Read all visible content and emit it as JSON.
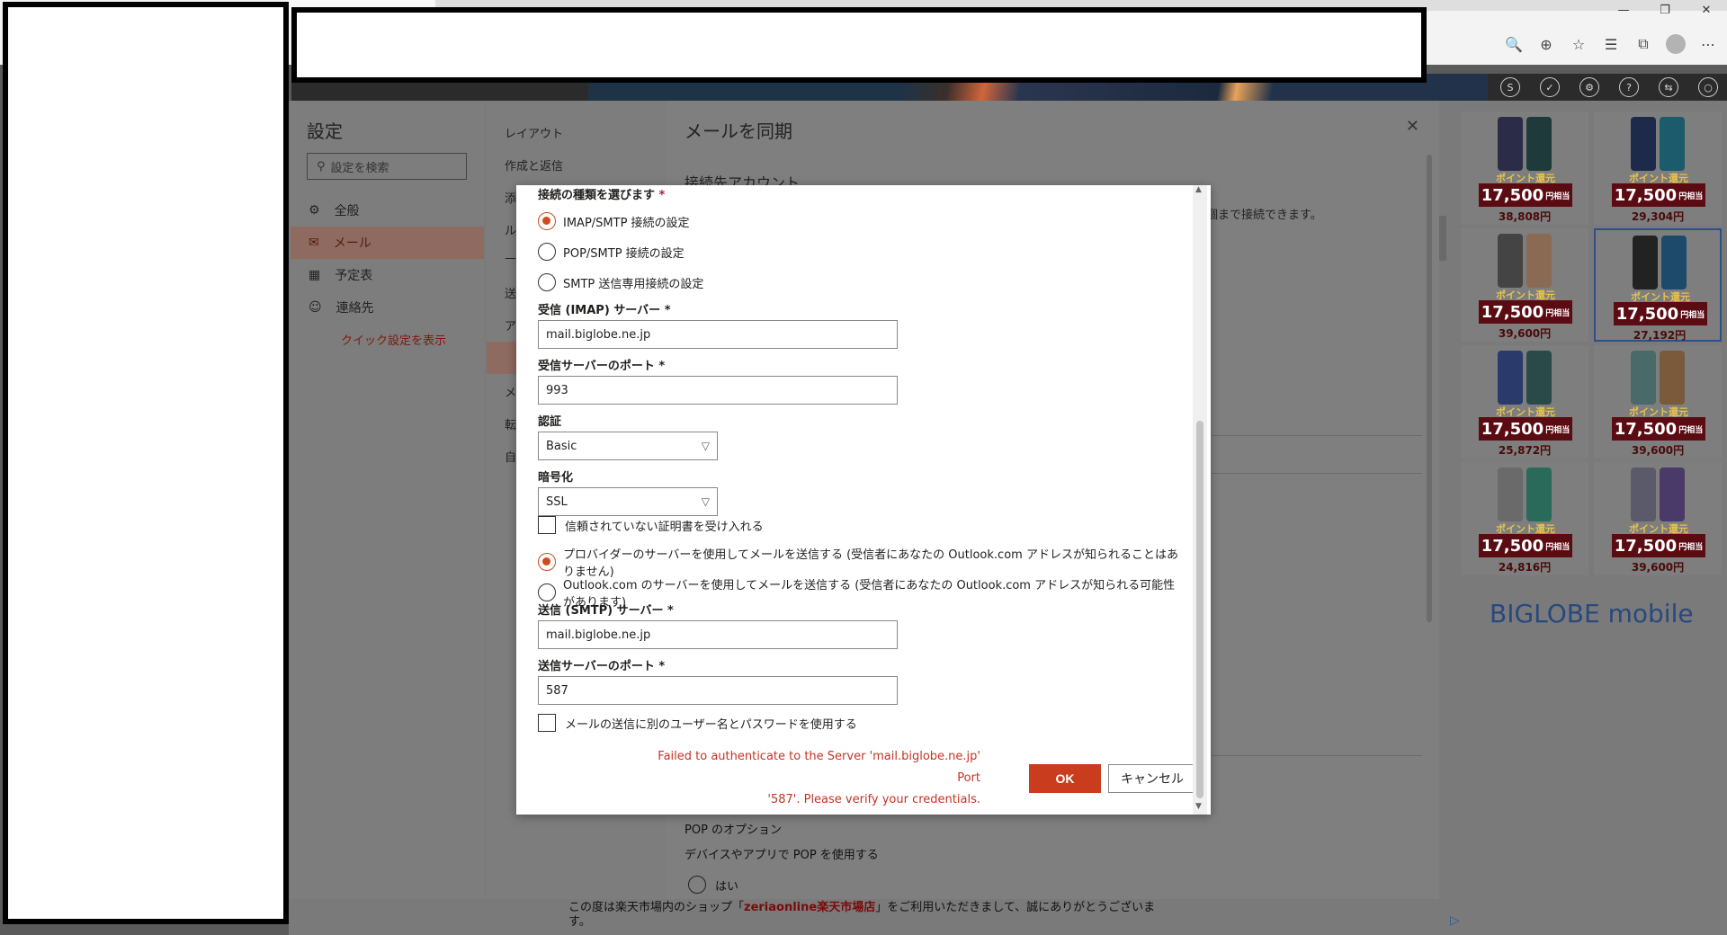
{
  "browser": {
    "window_controls": [
      "—",
      "❐",
      "✕"
    ],
    "toolbar_icons": [
      "🔍",
      "⊕",
      "☆",
      "☰",
      "⧉",
      "⋯"
    ]
  },
  "outlook_header_icons": [
    "S",
    "✓",
    "⚙",
    "?",
    "⇆",
    "○"
  ],
  "settings": {
    "title": "設定",
    "search_placeholder": "設定を検索",
    "nav": [
      {
        "label": "全般",
        "icon": "⚙"
      },
      {
        "label": "メール",
        "icon": "✉"
      },
      {
        "label": "予定表",
        "icon": "▦"
      },
      {
        "label": "連絡先",
        "icon": "☺"
      }
    ],
    "quick_settings": "クイック設定を表示",
    "mail_subnav": [
      "レイアウト",
      "作成と返信",
      "添",
      "ル",
      "—",
      "送",
      "ア",
      "メ",
      "メ",
      "転",
      "自"
    ]
  },
  "sync_panel": {
    "title": "メールを同期",
    "subtitle": "接続先アカウント",
    "side_text": "個まで接続できます。",
    "pop_options": "POP のオプション",
    "pop_use": "デバイスやアプリで POP を使用する",
    "pop_yes": "はい"
  },
  "modal": {
    "connection_type_label": "接続の種類を選びます",
    "required_mark": "*",
    "connection_options": [
      {
        "label": "IMAP/SMTP 接続の設定",
        "checked": true
      },
      {
        "label": "POP/SMTP 接続の設定",
        "checked": false
      },
      {
        "label": "SMTP 送信専用接続の設定",
        "checked": false
      }
    ],
    "incoming_server_label": "受信 (IMAP) サーバー *",
    "incoming_server_value": "mail.biglobe.ne.jp",
    "incoming_port_label": "受信サーバーのポート *",
    "incoming_port_value": "993",
    "auth_label": "認証",
    "auth_value": "Basic",
    "encryption_label": "暗号化",
    "encryption_value": "SSL",
    "accept_untrusted_cert": "信頼されていない証明書を受け入れる",
    "send_options": [
      {
        "label": "プロバイダーのサーバーを使用してメールを送信する (受信者にあなたの Outlook.com アドレスが知られることはありません)",
        "checked": true
      },
      {
        "label": "Outlook.com のサーバーを使用してメールを送信する (受信者にあなたの Outlook.com アドレスが知られる可能性があります)",
        "checked": false
      }
    ],
    "outgoing_server_label": "送信 (SMTP) サーバー *",
    "outgoing_server_value": "mail.biglobe.ne.jp",
    "outgoing_port_label": "送信サーバーのポート *",
    "outgoing_port_value": "587",
    "separate_credentials": "メールの送信に別のユーザー名とパスワードを使用する",
    "error_line1": "Failed to authenticate to the Server 'mail.biglobe.ne.jp' Port",
    "error_line2": "'587'. Please verify your credentials.",
    "ok_label": "OK",
    "cancel_label": "キャンセル"
  },
  "ads": {
    "badge_top": "ポイント還元",
    "badge_amount": "17,500",
    "badge_unit": "円相当",
    "prices": [
      "38,808円",
      "29,304円",
      "39,600円",
      "27,192円",
      "25,872円",
      "39,600円",
      "24,816円",
      "39,600円"
    ],
    "brand": "BIGLOBE mobile"
  },
  "footer": {
    "text_before": "この度は楽天市場内のショップ「",
    "shop": "zeriaonline楽天市場店",
    "text_after": "」をご利用いただきまして、誠にありがとうございます。"
  }
}
